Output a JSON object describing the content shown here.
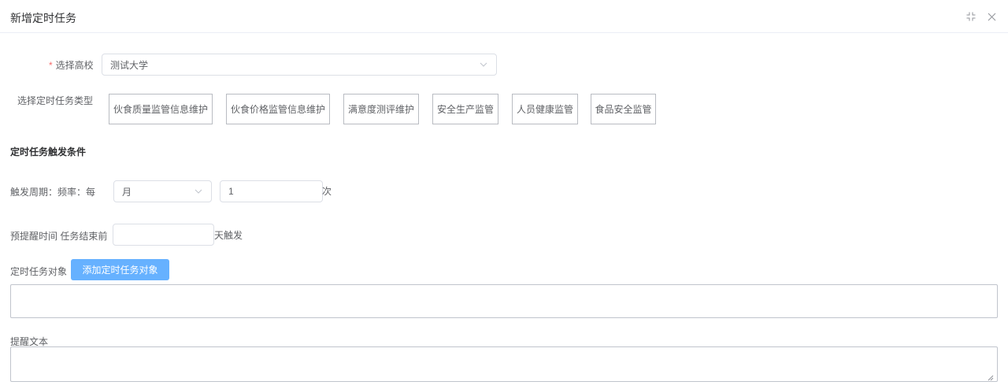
{
  "dialog": {
    "title": "新增定时任务",
    "icons": [
      "compress-icon",
      "close-icon"
    ]
  },
  "form": {
    "school": {
      "required_mark": "*",
      "label": "选择高校",
      "value": "测试大学"
    },
    "task_type": {
      "label": "选择定时任务类型",
      "options": [
        "伙食质量监管信息维护",
        "伙食价格监管信息维护",
        "满意度测评维护",
        "安全生产监管",
        "人员健康监管",
        "食品安全监管"
      ]
    },
    "trigger": {
      "section_title": "定时任务触发条件",
      "cycle_label": "触发周期：",
      "freq_label": "频率：",
      "every_label": "每",
      "period_value": "月",
      "count_value": "1",
      "times_suffix": "次"
    },
    "reminder": {
      "label": "预提醒时间",
      "before_label": "任务结束前",
      "days_value": "",
      "suffix": "天触发"
    },
    "target": {
      "label": "定时任务对象",
      "add_button": "添加定时任务对象"
    },
    "remind_text": {
      "label": "提醒文本",
      "value": ""
    }
  }
}
